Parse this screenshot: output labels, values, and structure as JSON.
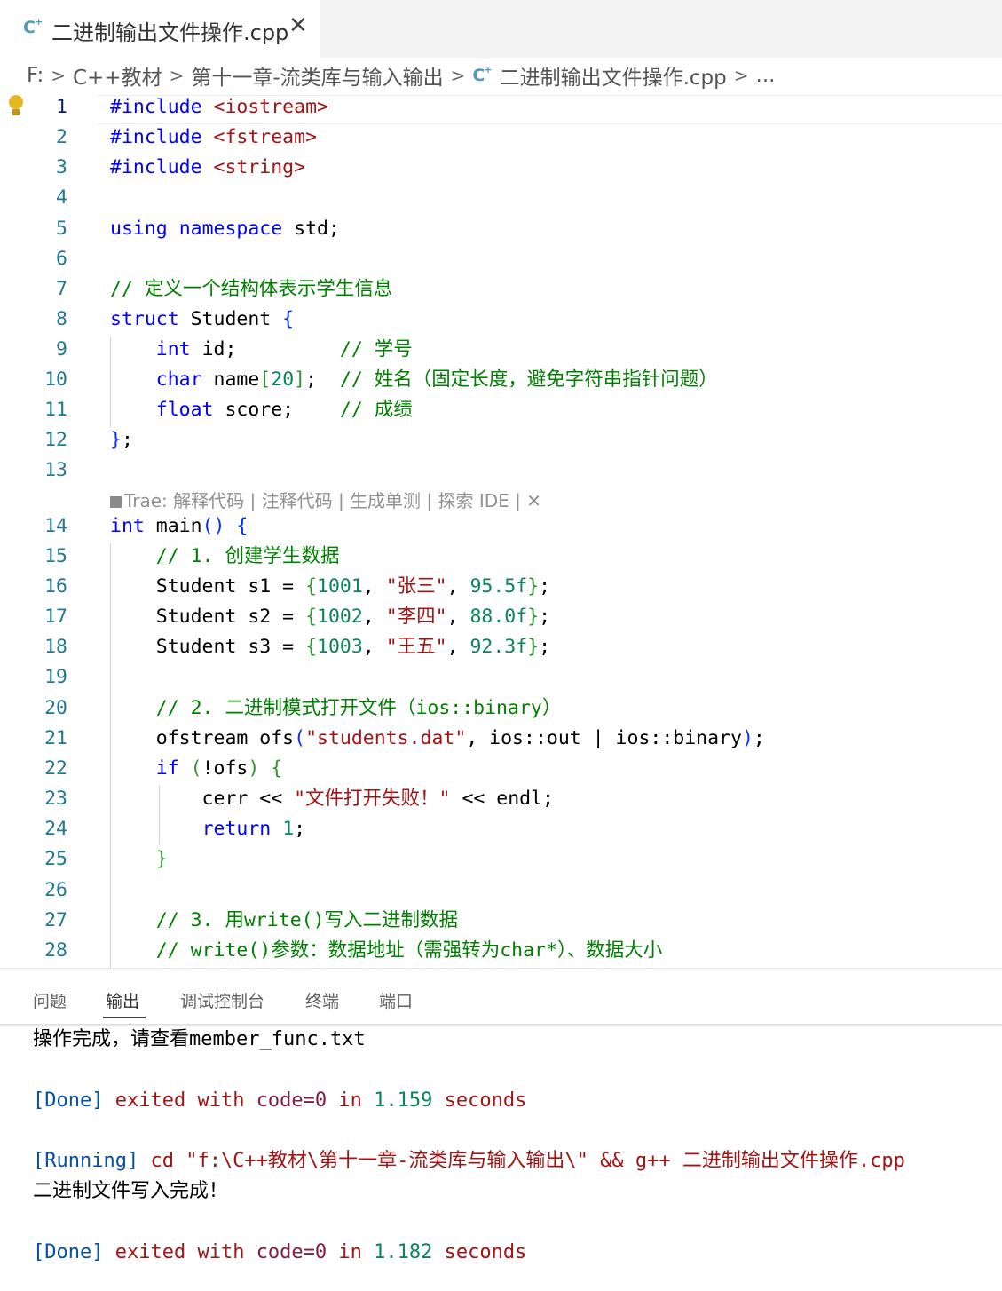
{
  "tab": {
    "icon": "cpp-file-icon",
    "title": "二进制输出文件操作.cpp",
    "close_glyph": "✕"
  },
  "breadcrumb": {
    "drive": "F:",
    "folder1": "C++教材",
    "folder2": "第十一章-流类库与输入输出",
    "file": "二进制输出文件操作.cpp",
    "more": "..."
  },
  "editor": {
    "line_numbers": [
      "1",
      "2",
      "3",
      "4",
      "5",
      "6",
      "7",
      "8",
      "9",
      "10",
      "11",
      "12",
      "13",
      "14",
      "15",
      "16",
      "17",
      "18",
      "19",
      "20",
      "21",
      "22",
      "23",
      "24",
      "25",
      "26",
      "27",
      "28"
    ],
    "lines": {
      "l1": [
        "#include",
        " ",
        "<iostream>"
      ],
      "l2": [
        "#include",
        " ",
        "<fstream>"
      ],
      "l3": [
        "#include",
        " ",
        "<string>"
      ],
      "l5": [
        "using",
        " ",
        "namespace",
        " std;"
      ],
      "l7": [
        "// 定义一个结构体表示学生信息"
      ],
      "l8": [
        "struct",
        " Student ",
        "{"
      ],
      "l9": [
        "    ",
        "int",
        " id;         ",
        "// 学号"
      ],
      "l10": [
        "    ",
        "char",
        " name",
        "[",
        "20",
        "]",
        ";  ",
        "// 姓名（固定长度，避免字符串指针问题）"
      ],
      "l11": [
        "    ",
        "float",
        " score;    ",
        "// 成绩"
      ],
      "l12": [
        "}",
        ";"
      ],
      "l14": [
        "int",
        " main",
        "()",
        " ",
        "{"
      ],
      "l15": [
        "    ",
        "// 1. 创建学生数据"
      ],
      "l16": [
        "    Student s1 = ",
        "{",
        "1001",
        ", ",
        "\"张三\"",
        ", ",
        "95.5f",
        "}",
        ";"
      ],
      "l17": [
        "    Student s2 = ",
        "{",
        "1002",
        ", ",
        "\"李四\"",
        ", ",
        "88.0f",
        "}",
        ";"
      ],
      "l18": [
        "    Student s3 = ",
        "{",
        "1003",
        ", ",
        "\"王五\"",
        ", ",
        "92.3f",
        "}",
        ";"
      ],
      "l20": [
        "    ",
        "// 2. 二进制模式打开文件（ios::binary）"
      ],
      "l21": [
        "    ofstream ofs",
        "(",
        "\"students.dat\"",
        ", ios::out | ios::binary",
        ")",
        ";"
      ],
      "l22": [
        "    ",
        "if",
        " ",
        "(",
        "!ofs",
        ")",
        " ",
        "{"
      ],
      "l23": [
        "        cerr << ",
        "\"文件打开失败！\"",
        " << endl;"
      ],
      "l24": [
        "        ",
        "return",
        " ",
        "1",
        ";"
      ],
      "l25": [
        "    ",
        "}"
      ],
      "l27": [
        "    ",
        "// 3. 用write()写入二进制数据"
      ],
      "l28": [
        "    ",
        "// write()参数：数据地址（需强转为char*）、数据大小"
      ]
    },
    "codelens": "Trae: 解释代码 | 注释代码 | 生成单测 | 探索 IDE | ✕"
  },
  "panel": {
    "tabs": [
      "问题",
      "输出",
      "调试控制台",
      "终端",
      "端口"
    ],
    "active_tab": "输出",
    "output": {
      "line1": "操作完成，请查看member_func.txt",
      "done1": [
        "[Done]",
        " exited ",
        "with",
        " ",
        "code=0",
        " in ",
        "1.159",
        " seconds"
      ],
      "running": [
        "[Running]",
        " cd ",
        "\"f:\\C++教材\\第十一章-流类库与输入输出\\\"",
        " && g++ ",
        "二进制输出文件操作.cpp"
      ],
      "line4": "二进制文件写入完成！",
      "done2": [
        "[Done]",
        " exited ",
        "with",
        " ",
        "code=0",
        " in ",
        "1.182",
        " seconds"
      ]
    }
  },
  "colors": {
    "keyword": "#0000ff",
    "string": "#a31515",
    "number": "#098658",
    "comment": "#008000",
    "line_number": "#237893",
    "bulb": "#e5b723"
  }
}
